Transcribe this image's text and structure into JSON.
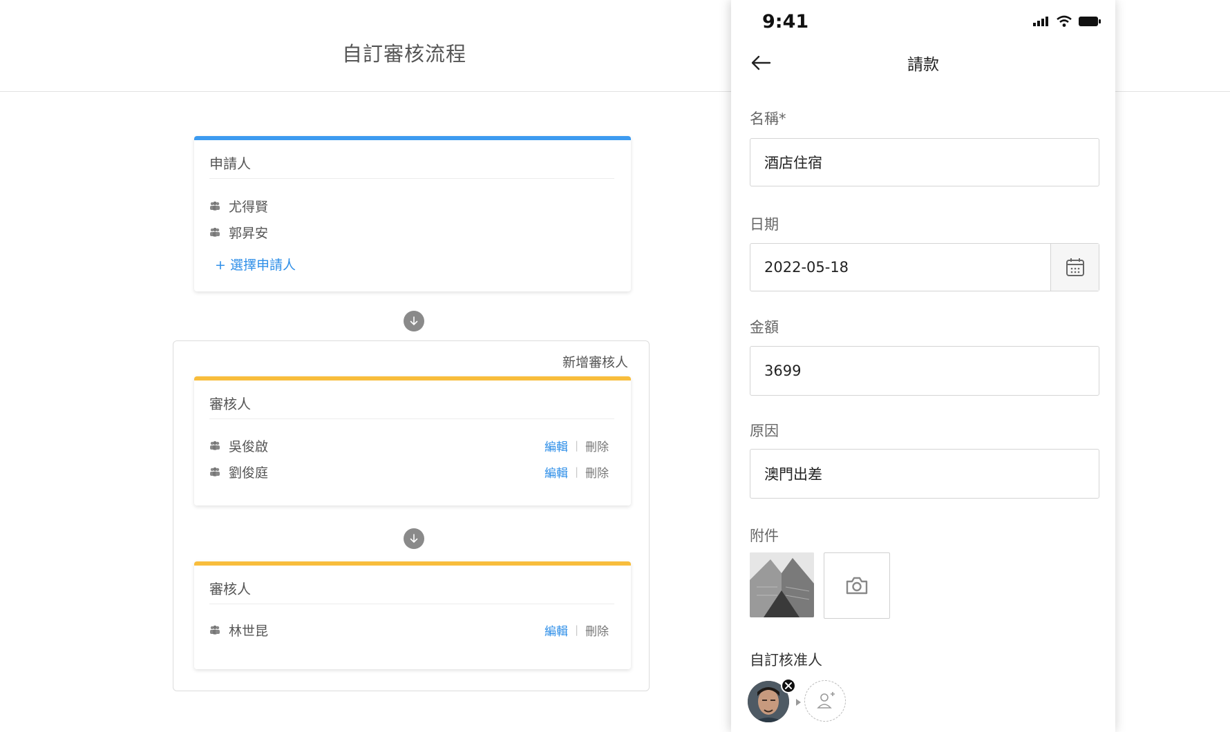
{
  "workflow": {
    "title": "自訂審核流程",
    "applicant_card": {
      "title": "申請人",
      "people": [
        "尤得賢",
        "郭昇安"
      ],
      "add_label": "+ 選擇申請人"
    },
    "group": {
      "add_reviewer_label": "新增審核人",
      "reviewer_cards": [
        {
          "title": "審核人",
          "people": [
            "吳俊啟",
            "劉俊庭"
          ]
        },
        {
          "title": "審核人",
          "people": [
            "林世昆"
          ]
        }
      ]
    },
    "edit_label": "編輯",
    "delete_label": "刪除",
    "colors": {
      "applicant_bar": "#3d9bf0",
      "reviewer_bar": "#f8bd3c",
      "link": "#2f8fe8"
    }
  },
  "phone": {
    "status_time": "9:41",
    "nav_title": "請款",
    "fields": {
      "name": {
        "label": "名稱*",
        "value": "酒店住宿"
      },
      "date": {
        "label": "日期",
        "value": "2022-05-18"
      },
      "amount": {
        "label": "金額",
        "value": "3699"
      },
      "reason": {
        "label": "原因",
        "value": "澳門出差"
      }
    },
    "attachments_label": "附件",
    "approvers_label": "自訂核准人"
  }
}
